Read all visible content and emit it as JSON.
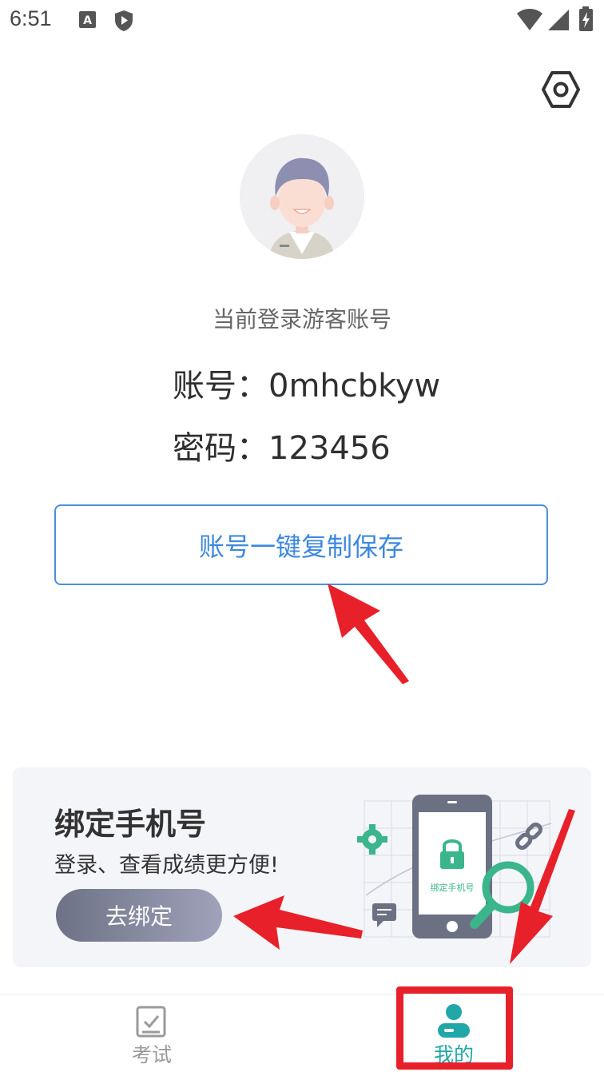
{
  "status_bar": {
    "time": "6:51"
  },
  "profile": {
    "guest_caption": "当前登录游客账号",
    "account_label": "账号：",
    "account_value": "0mhcbkyw",
    "password_label": "密码：",
    "password_value": "123456",
    "copy_button_label": "账号一键复制保存"
  },
  "bind_card": {
    "title": "绑定手机号",
    "subtitle": "登录、查看成绩更方便!",
    "button_label": "去绑定",
    "illustration_text": "绑定手机号"
  },
  "tab_bar": {
    "tabs": [
      {
        "label": "考试",
        "icon": "exam-icon",
        "active": false
      },
      {
        "label": "我的",
        "icon": "person-icon",
        "active": true
      }
    ]
  },
  "colors": {
    "accent": "#3d88e0",
    "tab_active": "#22a7a8",
    "annotation_red": "#e8202a"
  }
}
